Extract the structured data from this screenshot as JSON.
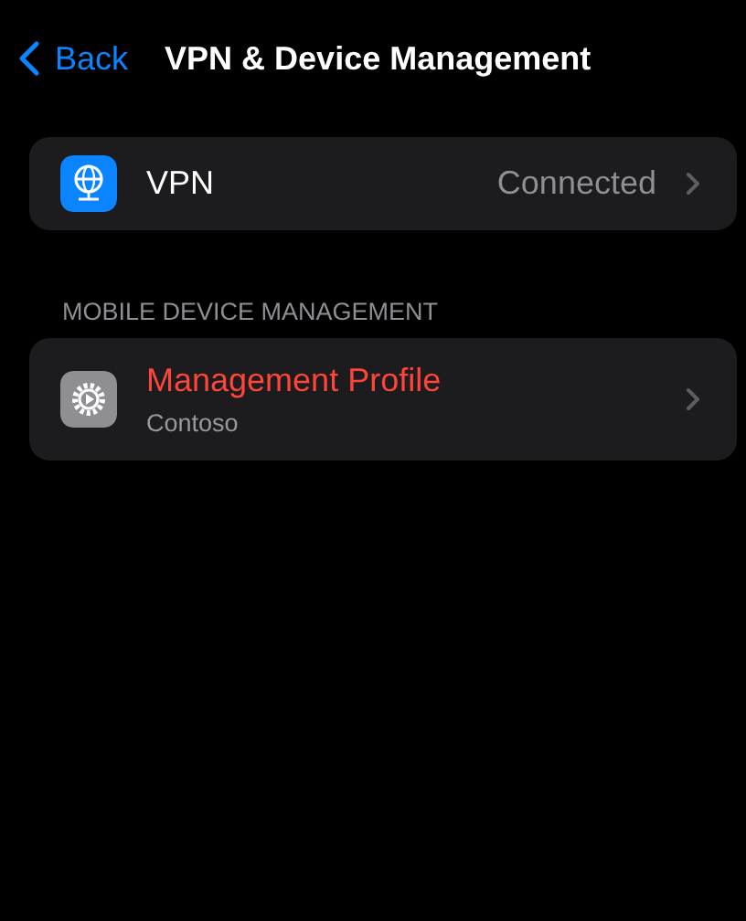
{
  "nav": {
    "back": "Back",
    "title": "VPN & Device Management"
  },
  "vpn": {
    "label": "VPN",
    "value": "Connected"
  },
  "mdm": {
    "header": "MOBILE DEVICE MANAGEMENT",
    "title": "Management Profile",
    "subtitle": "Contoso"
  }
}
